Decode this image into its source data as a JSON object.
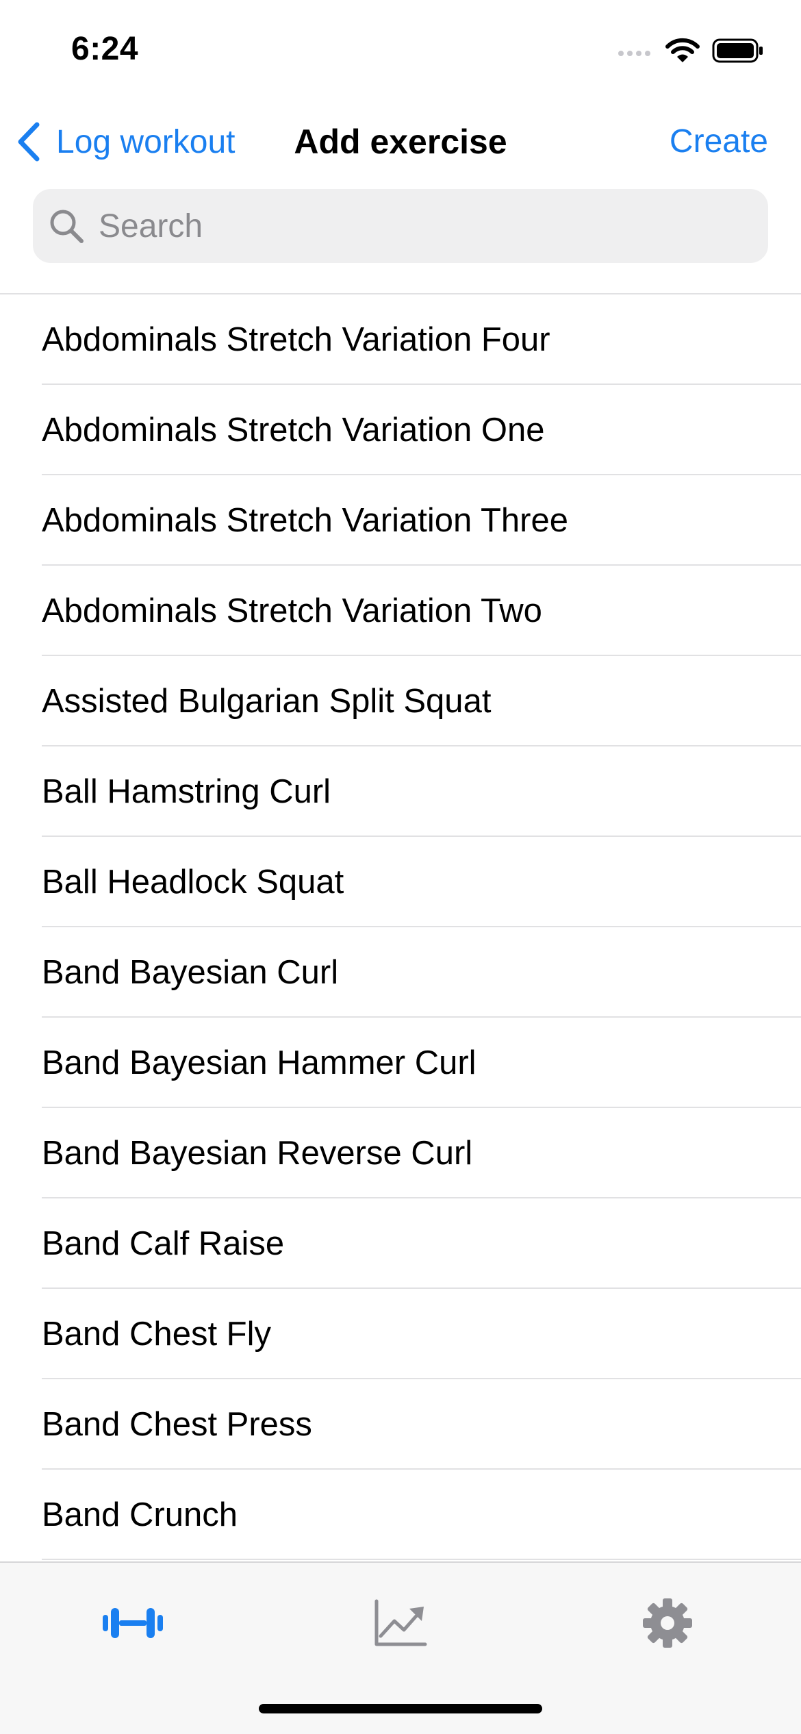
{
  "status_bar": {
    "time": "6:24"
  },
  "nav": {
    "back_label": "Log workout",
    "title": "Add exercise",
    "create_label": "Create"
  },
  "search": {
    "placeholder": "Search",
    "value": ""
  },
  "exercises": [
    "Abdominals Stretch Variation Four",
    "Abdominals Stretch Variation One",
    "Abdominals Stretch Variation Three",
    "Abdominals Stretch Variation Two",
    "Assisted Bulgarian Split Squat",
    "Ball Hamstring Curl",
    "Ball Headlock Squat",
    "Band Bayesian Curl",
    "Band Bayesian Hammer Curl",
    "Band Bayesian Reverse Curl",
    "Band Calf Raise",
    "Band Chest Fly",
    "Band Chest Press",
    "Band Crunch"
  ],
  "tab_bar": {
    "tabs": [
      {
        "icon": "dumbbell-icon",
        "active": true
      },
      {
        "icon": "chart-line-icon",
        "active": false
      },
      {
        "icon": "gear-icon",
        "active": false
      }
    ]
  },
  "colors": {
    "accent": "#1a7ff0",
    "inactive_tab": "#8e8e93",
    "search_background": "#efeff0",
    "separator": "#e1e1e3"
  }
}
